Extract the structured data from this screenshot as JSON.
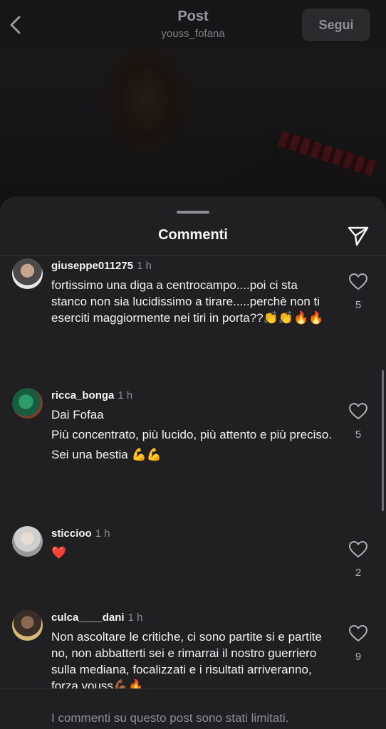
{
  "header": {
    "title": "Post",
    "username": "youss_fofana",
    "follow_label": "Segui"
  },
  "sheet": {
    "title": "Commenti"
  },
  "comments": [
    {
      "username": "giuseppe011275",
      "time": "1 h",
      "lines": [
        "fortissimo una diga a centrocampo....poi ci sta stanco non sia lucidissimo a tirare.....perchè non ti eserciti maggiormente nei tiri in porta??👏👏🔥🔥"
      ],
      "likes": "5"
    },
    {
      "username": "ricca_bonga",
      "time": "1 h",
      "lines": [
        "Dai Fofaa",
        "Più concentrato, più lucido, più attento e più preciso.",
        "Sei una bestia 💪💪"
      ],
      "likes": "5"
    },
    {
      "username": "sticcioo",
      "time": "1 h",
      "lines": [
        "❤️"
      ],
      "likes": "2"
    },
    {
      "username": "culca____dani",
      "time": "1 h",
      "lines": [
        "Non ascoltare le critiche, ci sono partite si e partite no, non abbatterti sei e rimarrai il nostro guerriero sulla mediana, focalizzati e i risultati arriveranno, forza youss💪🏾🔥"
      ],
      "likes": "9"
    }
  ],
  "footer": {
    "note": "I commenti su questo post sono stati limitati."
  },
  "colors": {
    "sheet_bg": "#202023",
    "heart_red": "#e0245e",
    "muted_text": "#8e8e93"
  },
  "icons": [
    "back-chevron-icon",
    "paper-plane-icon",
    "heart-icon"
  ]
}
